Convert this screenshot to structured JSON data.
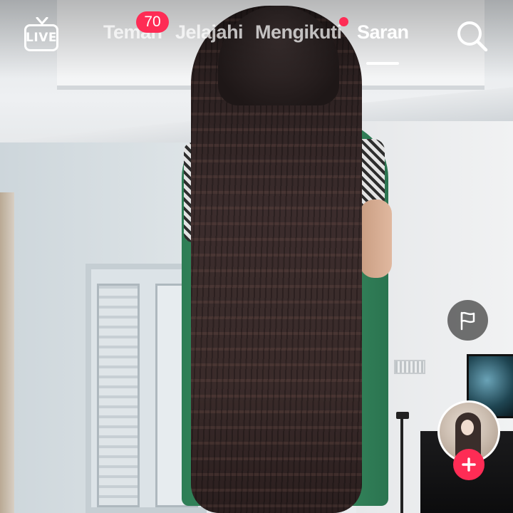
{
  "header": {
    "live_label": "LIVE",
    "tabs": [
      {
        "label": "Teman",
        "active": false
      },
      {
        "label": "Jelajahi",
        "active": false
      },
      {
        "label": "Mengikuti",
        "active": false
      },
      {
        "label": "Saran",
        "active": true
      }
    ],
    "friends_badge": "70",
    "following_dot": true
  },
  "icons": {
    "live": "live-tv-icon",
    "search": "search-icon",
    "report": "flag-icon",
    "follow": "plus-icon"
  },
  "colors": {
    "accent": "#fe2c55",
    "tab_active": "#ffffff",
    "tab_inactive": "#ffffffb8",
    "flag_bg": "#3c3c3cb8"
  }
}
